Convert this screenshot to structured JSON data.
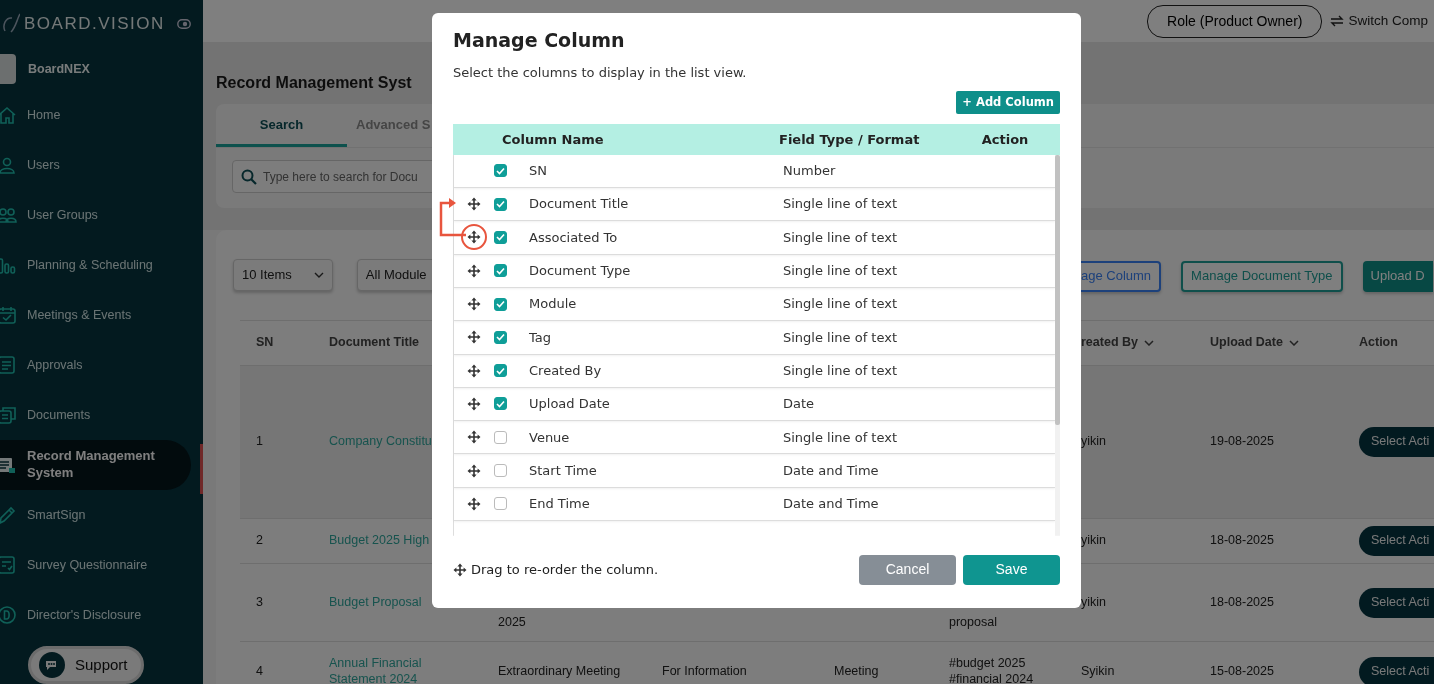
{
  "sidebar": {
    "logo": "BOARD.VISION",
    "org": "BoardNEX",
    "items": [
      {
        "label": "Home",
        "selected": false
      },
      {
        "label": "Users",
        "selected": false
      },
      {
        "label": "User Groups",
        "selected": false
      },
      {
        "label": "Planning & Scheduling",
        "selected": false
      },
      {
        "label": "Meetings & Events",
        "selected": false
      },
      {
        "label": "Approvals",
        "selected": false
      },
      {
        "label": "Documents",
        "selected": false
      },
      {
        "label": "Record Management System",
        "selected": true
      },
      {
        "label": "SmartSign",
        "selected": false
      },
      {
        "label": "Survey Questionnaire",
        "selected": false
      },
      {
        "label": "Director's Disclosure",
        "selected": false
      }
    ],
    "support": "Support"
  },
  "topbar": {
    "role": "Role (Product Owner)",
    "switch": "Switch Comp"
  },
  "page": {
    "title": "Record Management Syst",
    "tabs": [
      {
        "label": "Search",
        "selected": true
      },
      {
        "label": "Advanced S",
        "selected": false
      }
    ],
    "search": {
      "placeholder": "Type here to search for Docu"
    },
    "page_size": "10 Items",
    "module_filter": "All Module",
    "buttons": [
      {
        "label": "age Column",
        "kind": "outline-blue"
      },
      {
        "label": "Manage Document Type",
        "kind": "outline"
      },
      {
        "label": "Upload D",
        "kind": "filled"
      }
    ]
  },
  "table": {
    "header": {
      "sn": {
        "label": "SN",
        "sortable": false
      },
      "document_title": {
        "label": "Document Title",
        "sortable": false
      },
      "created_by": {
        "label": "reated By",
        "sortable": true
      },
      "upload_date": {
        "label": "Upload Date",
        "sortable": true
      },
      "action": {
        "label": "Action",
        "sortable": false
      }
    },
    "rows": [
      {
        "sn": "1",
        "document_title": "Company Constitu",
        "created_by": "yikin",
        "upload_date": "19-08-2025",
        "action": "Select Acti"
      },
      {
        "sn": "2",
        "document_title": "Budget 2025 High",
        "created_by": "yikin",
        "upload_date": "18-08-2025",
        "action": "Select Acti"
      },
      {
        "sn": "3",
        "document_title": "Budget Proposal",
        "column_3": "2025",
        "column_6": "proposal",
        "created_by": "yikin",
        "upload_date": "18-08-2025",
        "action": "Select Acti"
      },
      {
        "sn": "4",
        "document_title": "Annual Financial Statement 2024",
        "column_3": "Extraordinary Meeting",
        "column_4": "For Information",
        "column_5": "Meeting",
        "column_6": "#budget 2025 #financial 2024",
        "created_by": "Syikin",
        "upload_date": "15-08-2025",
        "action": "Select Acti"
      }
    ]
  },
  "modal": {
    "title": "Manage Column",
    "subtitle": "Select the columns to display in the list view.",
    "add_button": "+ Add Column",
    "columns": [
      "Column Name",
      "Field Type / Format",
      "Action"
    ],
    "rows": [
      {
        "name": "SN",
        "field_type": "Number",
        "checked": true,
        "draggable": false,
        "highlighted": false
      },
      {
        "name": "Document Title",
        "field_type": "Single line of text",
        "checked": true,
        "draggable": true,
        "highlighted": false
      },
      {
        "name": "Associated To",
        "field_type": "Single line of text",
        "checked": true,
        "draggable": true,
        "highlighted": true
      },
      {
        "name": "Document Type",
        "field_type": "Single line of text",
        "checked": true,
        "draggable": true,
        "highlighted": false
      },
      {
        "name": "Module",
        "field_type": "Single line of text",
        "checked": true,
        "draggable": true,
        "highlighted": false
      },
      {
        "name": "Tag",
        "field_type": "Single line of text",
        "checked": true,
        "draggable": true,
        "highlighted": false
      },
      {
        "name": "Created By",
        "field_type": "Single line of text",
        "checked": true,
        "draggable": true,
        "highlighted": false
      },
      {
        "name": "Upload Date",
        "field_type": "Date",
        "checked": true,
        "draggable": true,
        "highlighted": false
      },
      {
        "name": "Venue",
        "field_type": "Single line of text",
        "checked": false,
        "draggable": true,
        "highlighted": false
      },
      {
        "name": "Start Time",
        "field_type": "Date and Time",
        "checked": false,
        "draggable": true,
        "highlighted": false
      },
      {
        "name": "End Time",
        "field_type": "Date and Time",
        "checked": false,
        "draggable": true,
        "highlighted": false
      }
    ],
    "hint": "Drag to re-order the column.",
    "cancel": "Cancel",
    "save": "Save"
  }
}
